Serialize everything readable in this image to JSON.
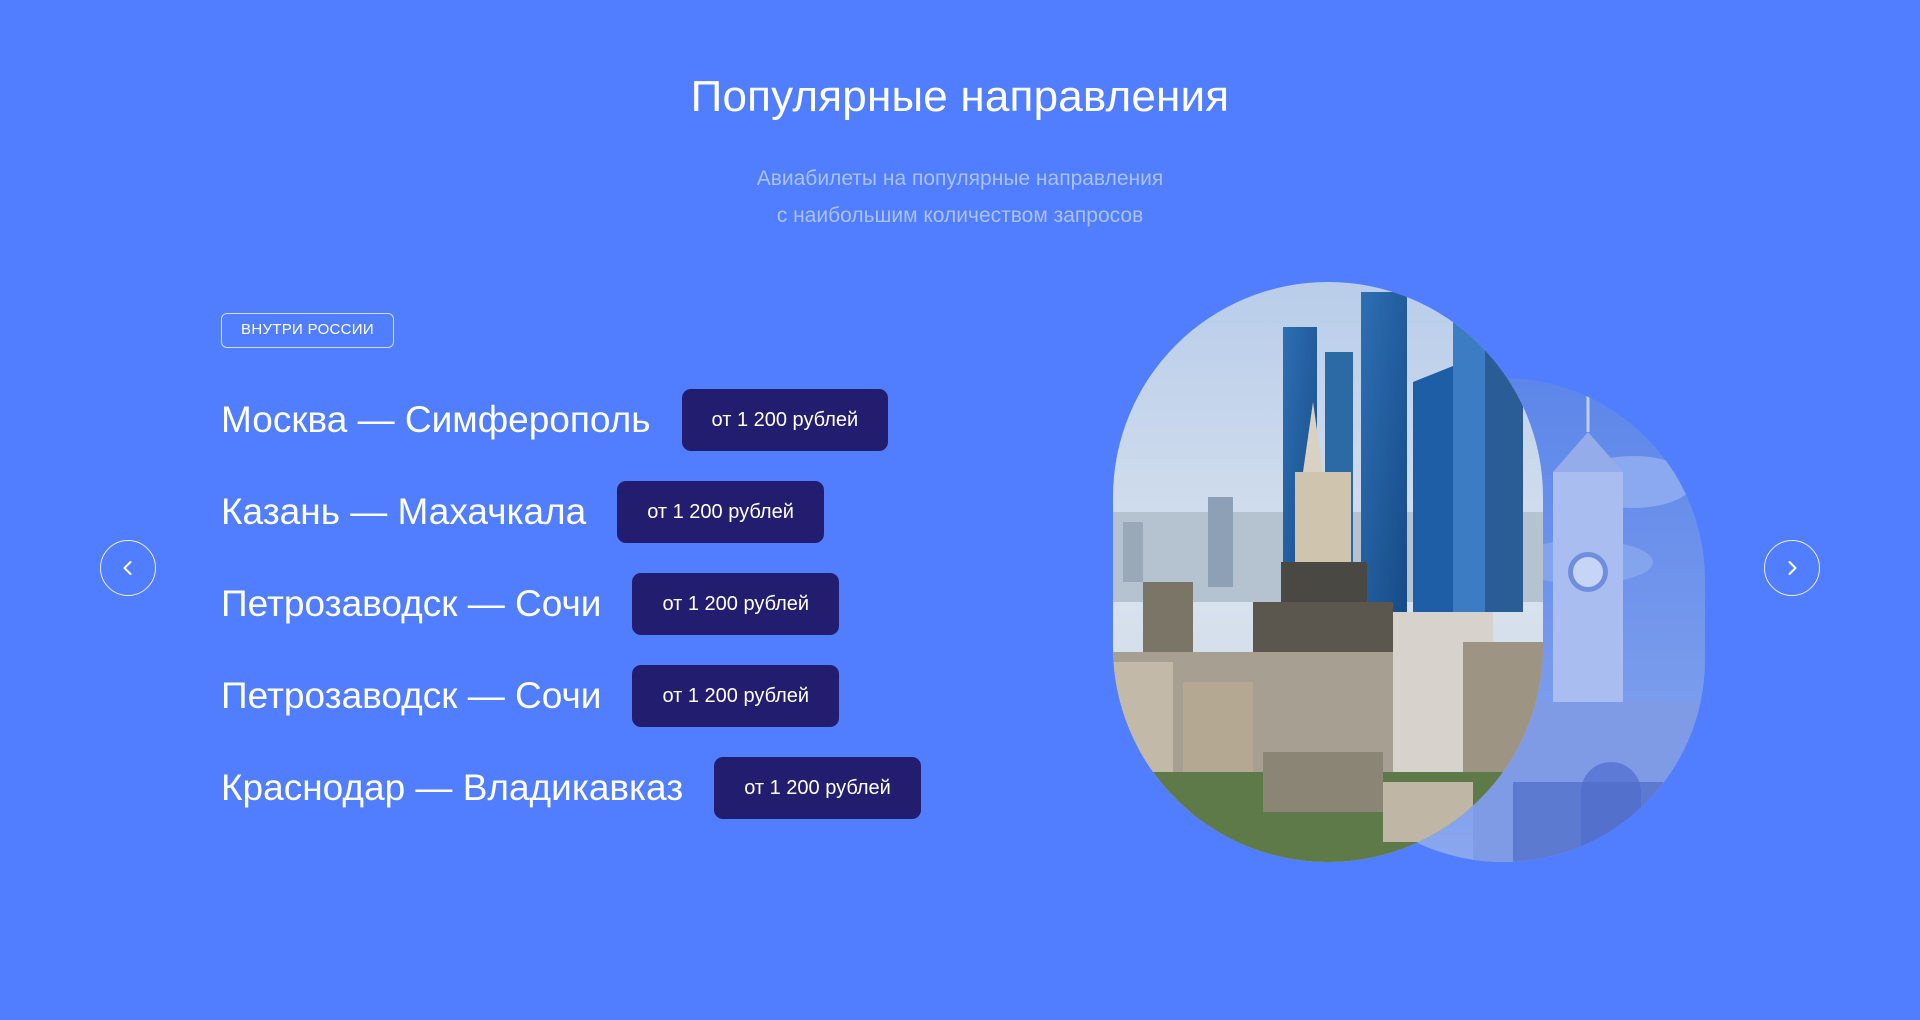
{
  "section": {
    "title": "Популярные направления",
    "subtitle_lines": [
      "Авиабилеты на популярные направления",
      "с наибольшим количеством запросов"
    ]
  },
  "filter_tag": "ВНУТРИ РОССИИ",
  "routes": [
    {
      "name": "Москва — Симферополь",
      "price": "от 1 200 рублей"
    },
    {
      "name": "Казань — Махачкала",
      "price": "от 1 200 рублей"
    },
    {
      "name": "Петрозаводск — Сочи",
      "price": "от 1 200 рублей"
    },
    {
      "name": "Петрозаводск — Сочи",
      "price": "от 1 200 рублей"
    },
    {
      "name": "Краснодар — Владикавказ",
      "price": "от 1 200 рублей"
    }
  ],
  "navigation": {
    "prev_icon": "chevron-left-icon",
    "next_icon": "chevron-right-icon"
  },
  "images": {
    "primary": "moscow-city-skyline",
    "secondary": "simferopol-clock-tower"
  },
  "colors": {
    "background": "#517dff",
    "price_badge": "#221d6f",
    "subtitle": "#a9c2ff",
    "text": "#ffffff"
  }
}
